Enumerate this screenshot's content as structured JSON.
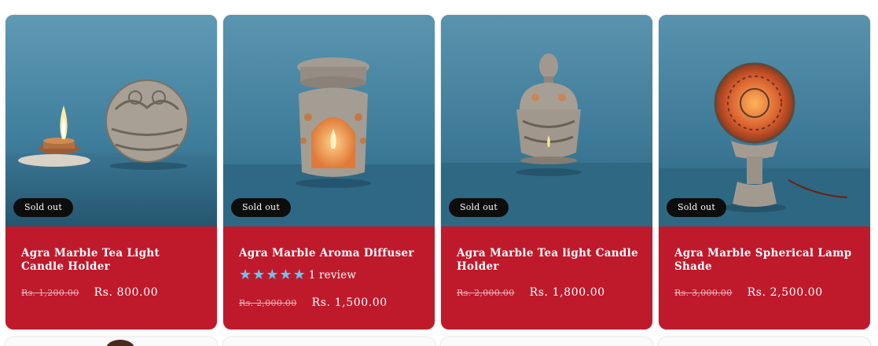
{
  "products": [
    {
      "badge": "Sold out",
      "title": "Agra Marble Tea Light Candle Holder",
      "compare_price": "Rs. 1,200.00",
      "price": "Rs. 800.00",
      "image_icon": "sphere-candle-holder-with-tealight"
    },
    {
      "badge": "Sold out",
      "title": "Agra Marble Aroma Diffuser",
      "rating": {
        "stars": 5,
        "label": "1 review",
        "color": "#6ec3ec"
      },
      "compare_price": "Rs. 2,000.00",
      "price": "Rs. 1,500.00",
      "image_icon": "aroma-diffuser-with-candle"
    },
    {
      "badge": "Sold out",
      "title": "Agra Marble Tea light Candle Holder",
      "compare_price": "Rs. 2,000.00",
      "price": "Rs. 1,800.00",
      "image_icon": "domed-candle-holder"
    },
    {
      "badge": "Sold out",
      "title": "Agra Marble Spherical Lamp Shade",
      "compare_price": "Rs. 3,000.00",
      "price": "Rs. 2,500.00",
      "image_icon": "spherical-lamp-shade-lit"
    }
  ],
  "colors": {
    "card_background": "#be1a2c",
    "badge_background": "#0d0d0d",
    "photo_backdrop": "#3f7f9e",
    "star": "#6ec3ec"
  }
}
